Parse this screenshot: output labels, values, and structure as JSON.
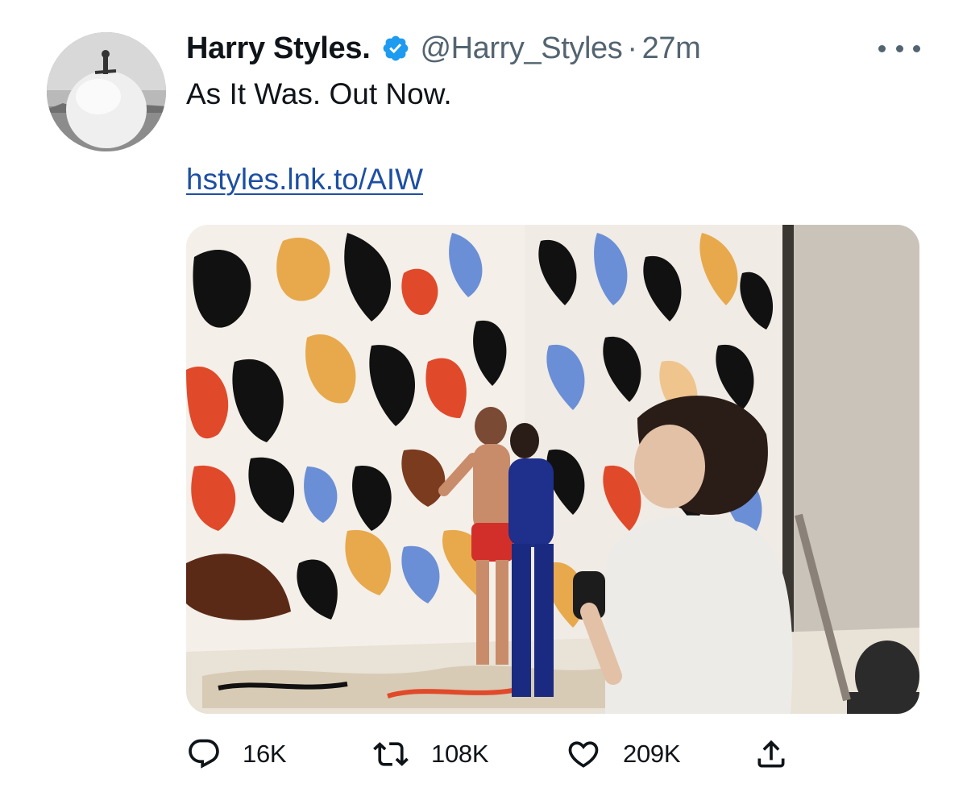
{
  "tweet": {
    "display_name": "Harry Styles.",
    "handle": "@Harry_Styles",
    "separator": "·",
    "timestamp": "27m",
    "text": "As It Was. Out Now.",
    "link": "hstyles.lnk.to/AIW",
    "verified": true
  },
  "icons": {
    "verified": "verified-badge-icon",
    "more": "more-dots-icon",
    "reply": "reply-bubble-icon",
    "retweet": "retweet-icon",
    "like": "heart-icon",
    "share": "share-upload-icon"
  },
  "actions": {
    "reply_count": "16K",
    "retweet_count": "108K",
    "like_count": "209K"
  },
  "colors": {
    "verified_badge": "#1d9bf0",
    "link": "#1d4fa3",
    "secondary_text": "#536471"
  }
}
